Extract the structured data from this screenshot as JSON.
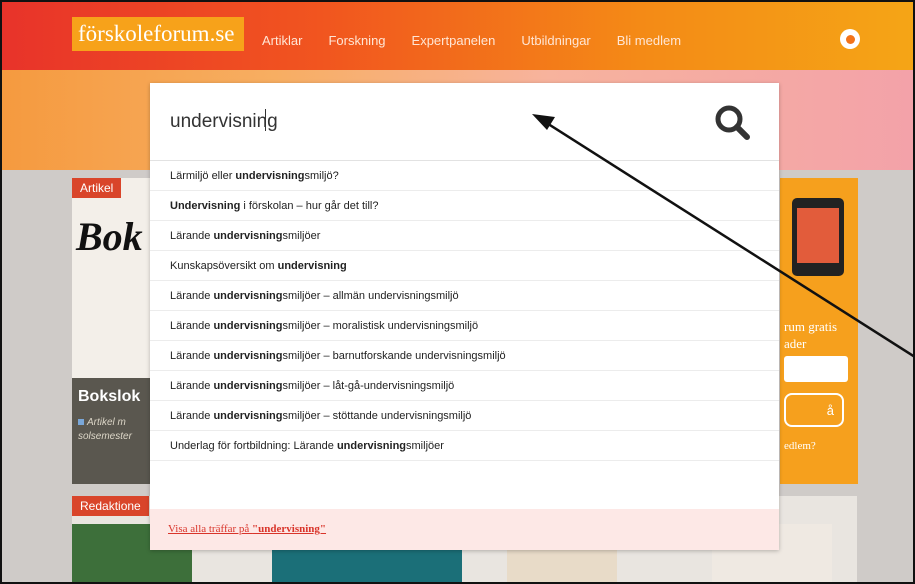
{
  "header": {
    "logo": "förskoleforum.se",
    "nav": [
      "Artiklar",
      "Forskning",
      "Expertpanelen",
      "Utbildningar",
      "Bli medlem"
    ],
    "user_icon": "user-icon"
  },
  "article_card": {
    "badge": "Artikel",
    "book_word": "Bok",
    "title": "Bokslok",
    "subtitle_line1": "Artikel m",
    "subtitle_line2": "solsemester"
  },
  "side_card": {
    "text_line1": "rum gratis",
    "text_line2": "ader",
    "button_fragment": "å",
    "link_fragment": "edlem?"
  },
  "editorial": {
    "badge": "Redaktione"
  },
  "search": {
    "value": "undervisning",
    "button_icon": "search-icon"
  },
  "suggestions": [
    {
      "before": "Lärmiljö eller ",
      "bold": "undervisning",
      "after": "smiljö?"
    },
    {
      "before": "",
      "bold": "Undervisning",
      "after": " i förskolan – hur går det till?"
    },
    {
      "before": "Lärande ",
      "bold": "undervisning",
      "after": "smiljöer"
    },
    {
      "before": "Kunskapsöversikt om ",
      "bold": "undervisning",
      "after": ""
    },
    {
      "before": "Lärande ",
      "bold": "undervisning",
      "after": "smiljöer – allmän undervisningsmiljö"
    },
    {
      "before": "Lärande ",
      "bold": "undervisning",
      "after": "smiljöer – moralistisk undervisningsmiljö"
    },
    {
      "before": "Lärande ",
      "bold": "undervisning",
      "after": "smiljöer – barnutforskande undervisningsmiljö"
    },
    {
      "before": "Lärande ",
      "bold": "undervisning",
      "after": "smiljöer – låt-gå-undervisningsmiljö"
    },
    {
      "before": "Lärande ",
      "bold": "undervisning",
      "after": "smiljöer – stöttande undervisningsmiljö"
    },
    {
      "before": "Underlag för fortbildning: Lärande ",
      "bold": "undervisning",
      "after": "smiljöer"
    }
  ],
  "show_all": {
    "prefix": "Visa alla träffar på ",
    "term": "\"undervisning\""
  },
  "colors": {
    "brand_orange": "#f48a16",
    "brand_red": "#e8332a",
    "link_red": "#d9342a"
  }
}
